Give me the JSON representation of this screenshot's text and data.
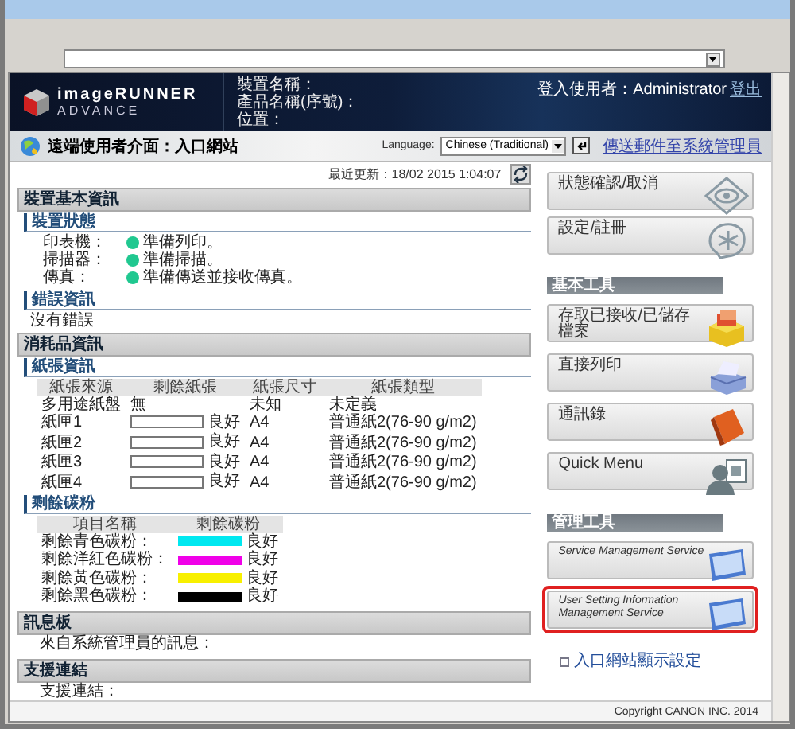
{
  "header": {
    "brand_top": "imageRUNNER",
    "brand_bottom": "ADVANCE",
    "device_fields": [
      "裝置名稱：",
      "產品名稱(序號)：",
      "位置："
    ],
    "login_label": "登入使用者：Administrator",
    "logout": "登出"
  },
  "title_bar": {
    "title": "遠端使用者介面：入口網站",
    "language_label": "Language:",
    "language_value": "Chinese (Traditional)",
    "mail_link": "傳送郵件至系統管理員"
  },
  "last_updated": "最近更新：18/02 2015 1:04:07",
  "device_info": {
    "title": "裝置基本資訊",
    "status": {
      "title": "裝置狀態",
      "rows": [
        {
          "label": "印表機：",
          "value": "準備列印。"
        },
        {
          "label": "掃描器：",
          "value": "準備掃描。"
        },
        {
          "label": "傳真：",
          "value": "準備傳送並接收傳真。"
        }
      ]
    },
    "errors": {
      "title": "錯誤資訊",
      "text": "沒有錯誤"
    }
  },
  "consumables": {
    "title": "消耗品資訊",
    "paper": {
      "title": "紙張資訊",
      "columns": [
        "紙張來源",
        "剩餘紙張",
        "紙張尺寸",
        "紙張類型"
      ],
      "rows": [
        {
          "kind": "text",
          "source": "多用途紙盤",
          "remaining": "無",
          "size": "未知",
          "type": "未定義"
        },
        {
          "kind": "gauge",
          "source": "紙匣1",
          "remaining": "良好",
          "size": "A4",
          "type": "普通紙2(76-90 g/m2)"
        },
        {
          "kind": "gauge",
          "source": "紙匣2",
          "remaining": "良好",
          "size": "A4",
          "type": "普通紙2(76-90 g/m2)"
        },
        {
          "kind": "gauge",
          "source": "紙匣3",
          "remaining": "良好",
          "size": "A4",
          "type": "普通紙2(76-90 g/m2)"
        },
        {
          "kind": "gauge",
          "source": "紙匣4",
          "remaining": "良好",
          "size": "A4",
          "type": "普通紙2(76-90 g/m2)"
        }
      ]
    },
    "toner": {
      "title": "剩餘碳粉",
      "columns": [
        "項目名稱",
        "剩餘碳粉"
      ],
      "rows": [
        {
          "name": "剩餘青色碳粉：",
          "color": "#00e8f0",
          "status": "良好"
        },
        {
          "name": "剩餘洋紅色碳粉：",
          "color": "#f000e8",
          "status": "良好"
        },
        {
          "name": "剩餘黃色碳粉：",
          "color": "#f8f000",
          "status": "良好"
        },
        {
          "name": "剩餘黑色碳粉：",
          "color": "#000000",
          "status": "良好"
        }
      ]
    }
  },
  "message_board": {
    "title": "訊息板",
    "text": "來自系統管理員的訊息："
  },
  "support": {
    "title": "支援連結",
    "text": "支援連結："
  },
  "right": {
    "top_buttons": [
      {
        "label": "狀態確認/取消"
      },
      {
        "label": "設定/註冊"
      }
    ],
    "groups": [
      {
        "title": "基本工具",
        "buttons": [
          {
            "label": "存取已接收/已儲存檔案",
            "highlighted": false
          },
          {
            "label": "直接列印",
            "highlighted": false
          },
          {
            "label": "通訊錄",
            "highlighted": false
          },
          {
            "label": "Quick Menu",
            "highlighted": false
          }
        ]
      },
      {
        "title": "管理工具",
        "buttons": [
          {
            "label": "Service Management Service",
            "highlighted": false
          },
          {
            "label": "User Setting Information Management Service",
            "highlighted": true
          }
        ]
      }
    ],
    "link": "入口網站顯示設定"
  },
  "copyright": "Copyright CANON INC. 2014"
}
